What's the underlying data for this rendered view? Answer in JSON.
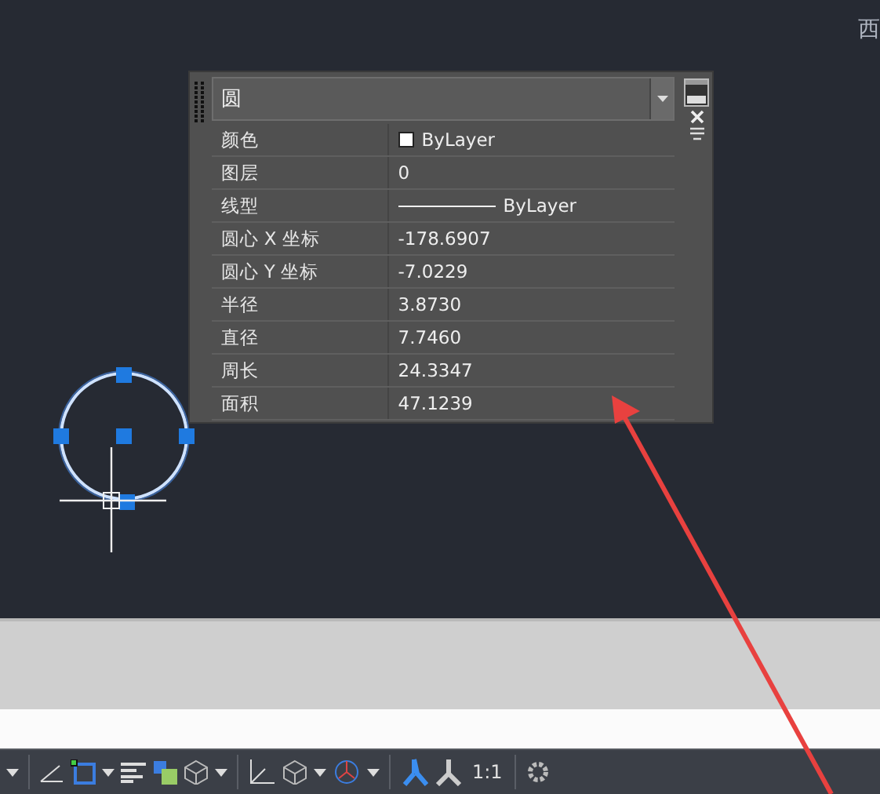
{
  "viewcube": {
    "label": "西"
  },
  "properties": {
    "object_type": "圆",
    "rows": [
      {
        "label": "颜色",
        "value": "ByLayer",
        "kind": "color"
      },
      {
        "label": "图层",
        "value": "0",
        "kind": "text"
      },
      {
        "label": "线型",
        "value": "ByLayer",
        "kind": "linetype"
      },
      {
        "label": "圆心 X 坐标",
        "value": "-178.6907",
        "kind": "text"
      },
      {
        "label": "圆心 Y 坐标",
        "value": "-7.0229",
        "kind": "text"
      },
      {
        "label": "半径",
        "value": "3.8730",
        "kind": "text"
      },
      {
        "label": "直径",
        "value": "7.7460",
        "kind": "text"
      },
      {
        "label": "周长",
        "value": "24.3347",
        "kind": "text"
      },
      {
        "label": "面积",
        "value": "47.1239",
        "kind": "text"
      }
    ]
  },
  "status_bar": {
    "scale": "1:1"
  }
}
